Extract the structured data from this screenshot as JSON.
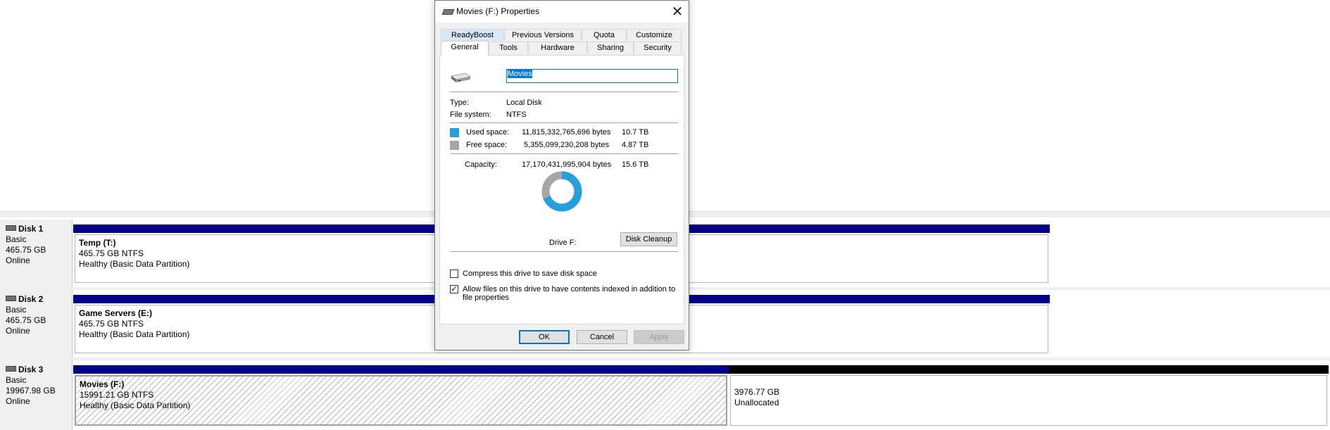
{
  "disks": [
    {
      "name": "Disk 1",
      "type": "Basic",
      "size": "465.75 GB",
      "status": "Online",
      "partitions": [
        {
          "title": "Temp  (T:)",
          "size_fs": "465.75 GB NTFS",
          "health": "Healthy (Basic Data Partition)"
        }
      ]
    },
    {
      "name": "Disk 2",
      "type": "Basic",
      "size": "465.75 GB",
      "status": "Online",
      "partitions": [
        {
          "title": "Game Servers  (E:)",
          "size_fs": "465.75 GB NTFS",
          "health": "Healthy (Basic Data Partition)"
        }
      ]
    },
    {
      "name": "Disk 3",
      "type": "Basic",
      "size": "19967.98 GB",
      "status": "Online",
      "partitions": [
        {
          "title": "Movies  (F:)",
          "size_fs": "15991.21 GB NTFS",
          "health": "Healthy (Basic Data Partition)"
        },
        {
          "size": "3976.77 GB",
          "label": "Unallocated"
        }
      ]
    }
  ],
  "dialog": {
    "title": "Movies (F:) Properties",
    "tabs_top": [
      "ReadyBoost",
      "Previous Versions",
      "Quota",
      "Customize"
    ],
    "tabs_bottom": [
      "General",
      "Tools",
      "Hardware",
      "Sharing",
      "Security"
    ],
    "volume_name": "Movies",
    "type_label": "Type:",
    "type_value": "Local Disk",
    "fs_label": "File system:",
    "fs_value": "NTFS",
    "used_label": "Used space:",
    "used_bytes": "11,815,332,765,696 bytes",
    "used_size": "10.7 TB",
    "free_label": "Free space:",
    "free_bytes": "5,355,099,230,208 bytes",
    "free_size": "4.87 TB",
    "capacity_label": "Capacity:",
    "capacity_bytes": "17,170,431,995,904 bytes",
    "capacity_size": "15.6 TB",
    "used_fraction": 0.688,
    "drive_label": "Drive F:",
    "disk_cleanup": "Disk Cleanup",
    "compress_label": "Compress this drive to save disk space",
    "compress_checked": false,
    "index_label_1": "Allow files on this drive to have contents indexed in addition to",
    "index_label_2": "file properties",
    "index_checked": true,
    "ok": "OK",
    "cancel": "Cancel",
    "apply": "Apply",
    "colors": {
      "used": "#26a0da",
      "free": "#a6a6a6",
      "accent": "#0078d7",
      "bar_primary": "#00008b",
      "bar_unallocated": "#000000"
    }
  }
}
